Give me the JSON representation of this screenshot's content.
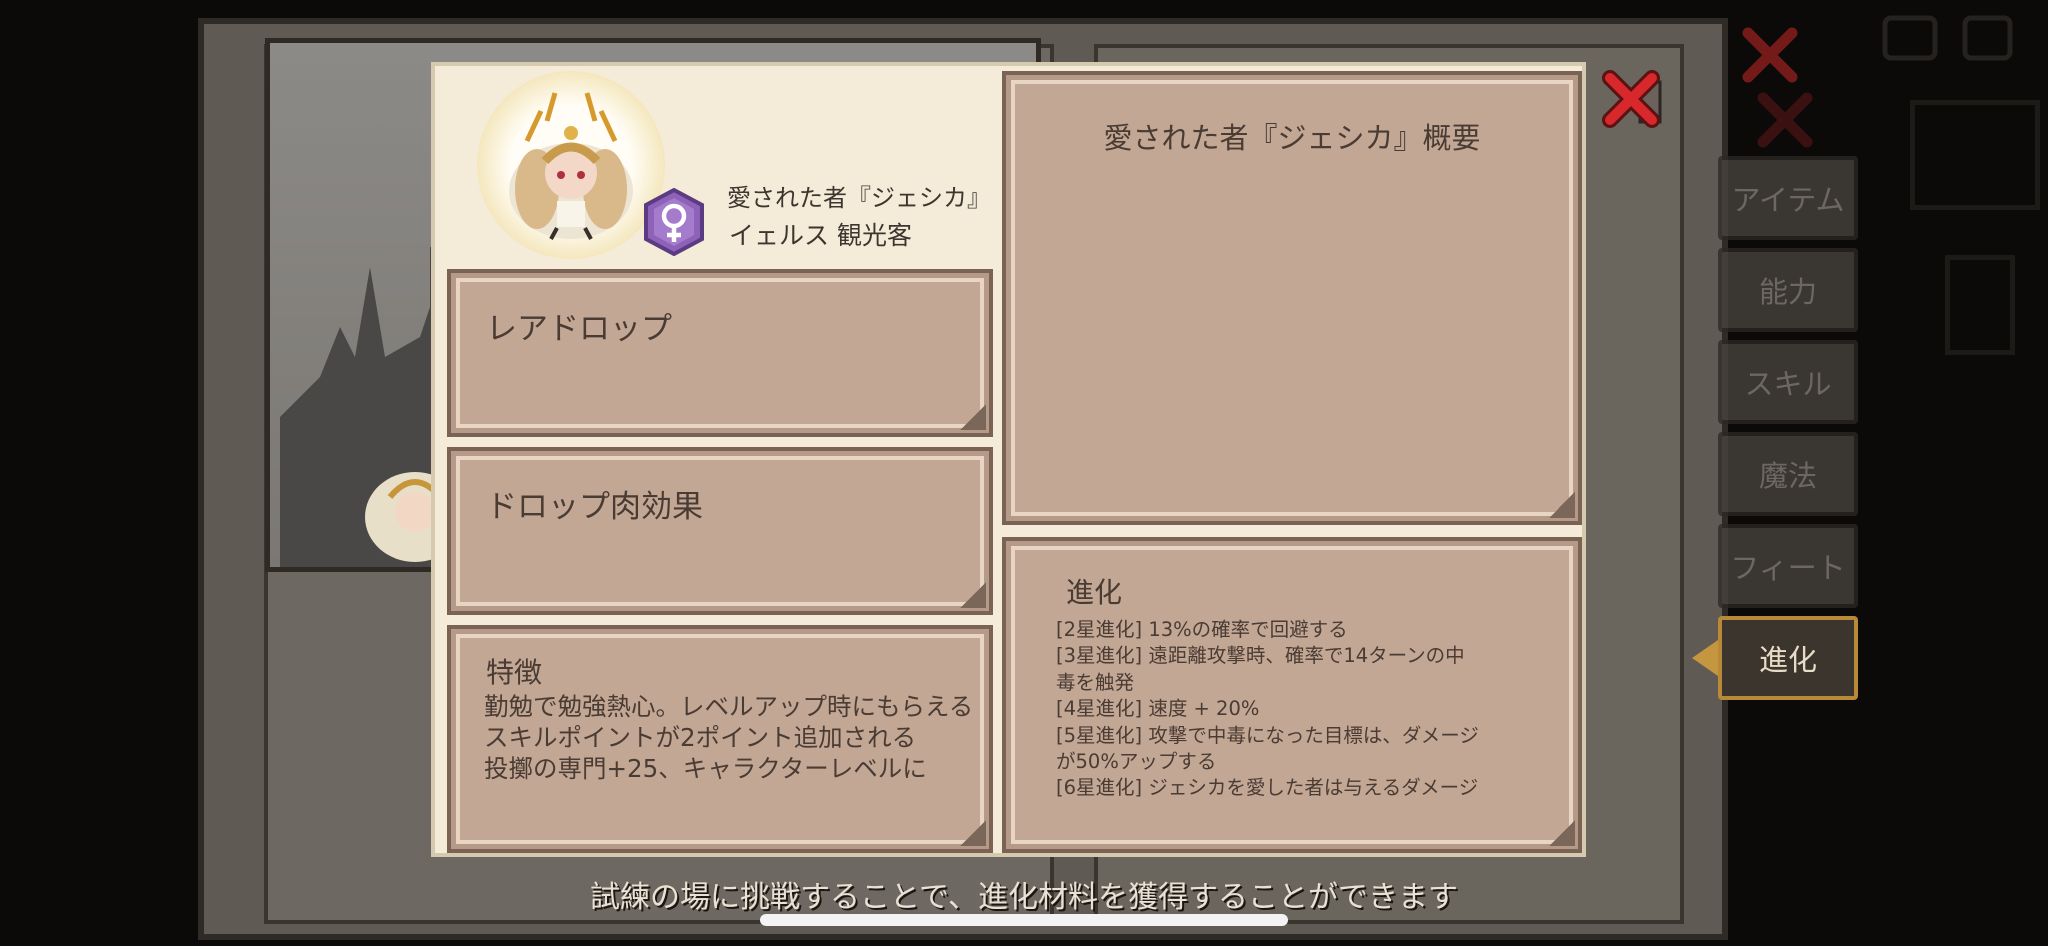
{
  "background": {
    "side_tabs": [
      {
        "label": "アイテム",
        "active": false
      },
      {
        "label": "能力",
        "active": false
      },
      {
        "label": "スキル",
        "active": false
      },
      {
        "label": "魔法",
        "active": false
      },
      {
        "label": "フィート",
        "active": false
      },
      {
        "label": "進化",
        "active": true
      }
    ]
  },
  "character": {
    "name": "愛された者『ジェシカ』",
    "title": "イェルス 観光客",
    "gender_icon": "female-symbol-icon"
  },
  "panels": {
    "rare_drop": {
      "title": "レアドロップ"
    },
    "meat_effect": {
      "title": "ドロップ肉効果"
    },
    "traits": {
      "title": "特徴",
      "body": "勤勉で勉強熱心。レベルアップ時にもらえるスキルポイントが2ポイント追加される\n投擲の専門+25、キャラクターレベルに"
    },
    "summary": {
      "title": "愛された者『ジェシカ』概要"
    },
    "evolution": {
      "title": "進化",
      "lines": [
        "[2星進化] 13%の確率で回避する",
        "[3星進化] 遠距離攻撃時、確率で14ターンの中",
        "毒を触発",
        "[4星進化] 速度 + 20%",
        "[5星進化] 攻撃で中毒になった目標は、ダメージ",
        "が50%アップする",
        "[6星進化] ジェシカを愛した者は与えるダメージ"
      ]
    }
  },
  "hint": "試練の場に挑戦することで、進化材料を獲得することができます",
  "colors": {
    "panel_fill": "#c2a795",
    "panel_border": "#7a6355",
    "dialog_bg": "#f4ecd9",
    "badge_purple": "#8e62b8",
    "close_red": "#d8282b",
    "active_tab_border": "#b88a38"
  }
}
